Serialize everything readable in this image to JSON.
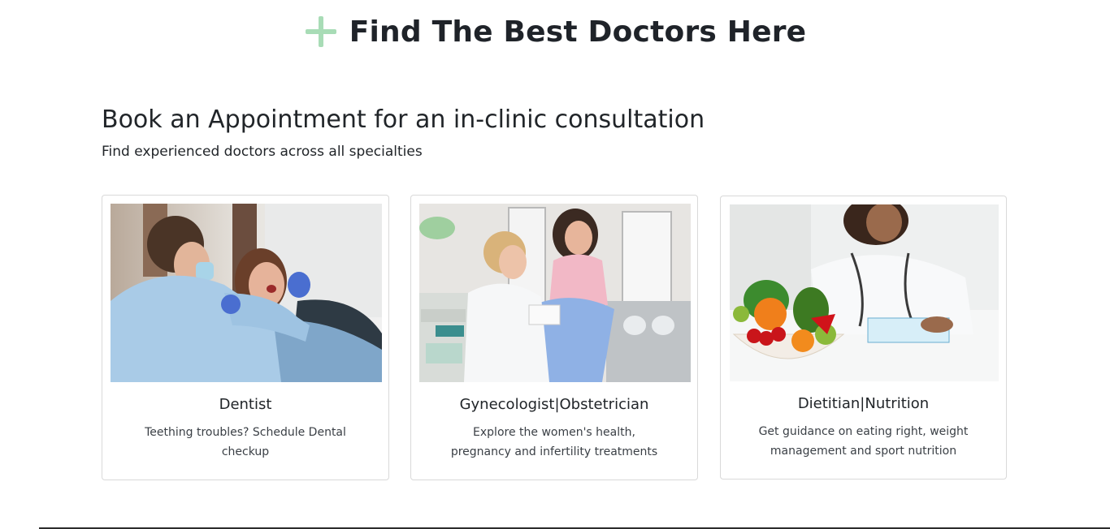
{
  "hero": {
    "title": "Find The Best Doctors Here",
    "icon": "plus-icon",
    "icon_color": "#a8dcb6"
  },
  "section": {
    "heading": "Book an Appointment for an in-clinic consultation",
    "subheading": "Find experienced doctors across all specialties"
  },
  "cards": [
    {
      "title": "Dentist",
      "text": "Teething troubles? Schedule Dental checkup",
      "image": "dentist-photo"
    },
    {
      "title": "Gynecologist|Obstetrician",
      "text": "Explore the women's health, pregnancy and infertility treatments",
      "image": "gynecologist-photo"
    },
    {
      "title": "Dietitian|Nutrition",
      "text": "Get guidance on eating right, weight management and sport nutrition",
      "image": "dietitian-photo"
    }
  ]
}
